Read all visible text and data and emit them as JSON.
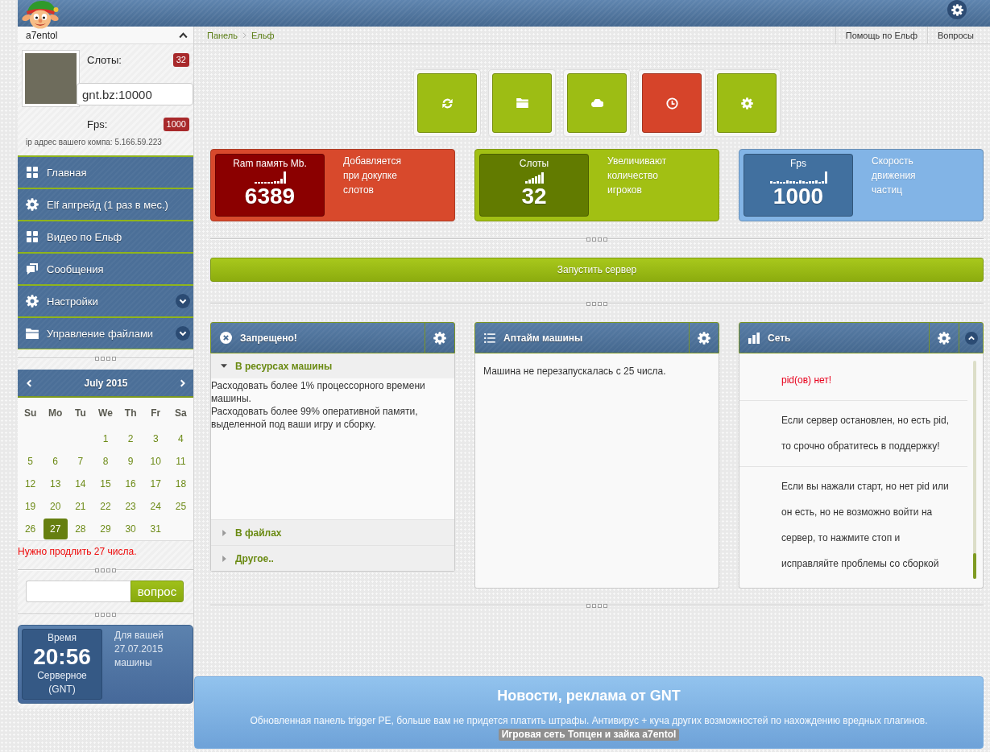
{
  "sidebar": {
    "user": {
      "name": "a7entol",
      "expanded": true
    },
    "profile": {
      "slots_label": "Слоты:",
      "slots_badge": "32",
      "server_field": {
        "value": "gnt.bz:10000"
      },
      "fps_label": "Fps:",
      "fps_badge": "1000",
      "ip_text": "ip адрес вашего компа: 5.166.59.223"
    },
    "menu": [
      {
        "label": "Главная",
        "has_submenu": false
      },
      {
        "label": "Elf апгрейд (1 раз в мес.)",
        "has_submenu": false
      },
      {
        "label": "Видео по Ельф",
        "has_submenu": false
      },
      {
        "label": "Сообщения",
        "has_submenu": false
      },
      {
        "label": "Настройки",
        "has_submenu": true
      },
      {
        "label": "Управление файлами",
        "has_submenu": true
      }
    ],
    "calendar": {
      "month": "July 2015",
      "weekdays": [
        "Su",
        "Mo",
        "Tu",
        "We",
        "Th",
        "Fr",
        "Sa"
      ],
      "weeks": [
        [
          {
            "day": "1",
            "selected": false
          },
          {
            "day": "2",
            "selected": false
          },
          {
            "day": "3",
            "selected": false
          },
          {
            "day": "4",
            "selected": false
          }
        ],
        [
          {
            "day": "5",
            "selected": false
          },
          {
            "day": "6",
            "selected": false
          },
          {
            "day": "7",
            "selected": false
          },
          {
            "day": "8",
            "selected": false
          },
          {
            "day": "9",
            "selected": false
          },
          {
            "day": "10",
            "selected": false
          },
          {
            "day": "11",
            "selected": false
          }
        ],
        [
          {
            "day": "12",
            "selected": false
          },
          {
            "day": "13",
            "selected": false
          },
          {
            "day": "14",
            "selected": false
          },
          {
            "day": "15",
            "selected": false
          },
          {
            "day": "16",
            "selected": false
          },
          {
            "day": "17",
            "selected": false
          },
          {
            "day": "18",
            "selected": false
          }
        ],
        [
          {
            "day": "19",
            "selected": false
          },
          {
            "day": "20",
            "selected": false
          },
          {
            "day": "21",
            "selected": false
          },
          {
            "day": "22",
            "selected": false
          },
          {
            "day": "23",
            "selected": false
          },
          {
            "day": "24",
            "selected": false
          },
          {
            "day": "25",
            "selected": false
          }
        ],
        [
          {
            "day": "26",
            "selected": false
          },
          {
            "day": "27",
            "selected": true
          },
          {
            "day": "28",
            "selected": false
          },
          {
            "day": "29",
            "selected": false
          },
          {
            "day": "30",
            "selected": false
          },
          {
            "day": "31",
            "selected": false
          }
        ]
      ]
    },
    "notice": "Нужно продлить 27 числа.",
    "question_form": {
      "button": "вопрос"
    },
    "clock": {
      "title": "Время",
      "time": "20:56",
      "zone": "Серверное (GNT)",
      "note": "Для вашей 27.07.2015 машины"
    }
  },
  "header": {
    "breadcrumb": [
      "Панель",
      "Ельф"
    ],
    "links": [
      "Помощь по Ельф",
      "Вопросы"
    ]
  },
  "quick_actions": [
    {
      "color": "#9dbd14"
    },
    {
      "color": "#9dbd14"
    },
    {
      "color": "#9dbd14"
    },
    {
      "color": "#d6442a"
    },
    {
      "color": "#9dbd14"
    }
  ],
  "stats": [
    {
      "label": "Ram память Mb.",
      "value": "6389",
      "description": "Добавляется при докупке слотов",
      "color": "#d8492c"
    },
    {
      "label": "Слоты",
      "value": "32",
      "description": "Увеличивают количество игроков",
      "color": "#a2c013"
    },
    {
      "label": "Fps",
      "value": "1000",
      "description": "Скорость движения частиц",
      "color": "#82b4e6"
    }
  ],
  "start_button": "Запустить сервер",
  "panels": [
    {
      "kind": "accordion",
      "title": "Запрещено!",
      "collapsible": false,
      "sections": [
        {
          "title": "В ресурсах машины",
          "expanded": true,
          "lines": [
            "Расходовать более 1% процессорного времени машины.",
            "Расходовать более 99% оперативной памяти, выделенной под ваши игру и сборку."
          ]
        },
        {
          "title": "В файлах",
          "expanded": false
        },
        {
          "title": "Другое..",
          "expanded": false
        }
      ]
    },
    {
      "kind": "text",
      "title": "Аптайм машины",
      "collapsible": false,
      "text": "Машина не перезапускалась с 25 числа."
    },
    {
      "kind": "feed",
      "title": "Сеть",
      "collapsible": true,
      "messages": [
        {
          "kind": "alert",
          "text": "pid(ов) нет!"
        },
        {
          "kind": "info",
          "text": "Если сервер остановлен, но есть pid, то срочно обратитесь в поддержку!"
        },
        {
          "kind": "info",
          "text": "Если вы нажали старт, но нет pid или он есть, но не возможно войти на сервер, то нажмите стоп и исправляйте проблемы со сборкой"
        }
      ]
    }
  ],
  "news": {
    "title": "Новости, реклама от GNT",
    "text": "Обновленная панель trigger PE, больше вам не придется платить штрафы. Антивирус + куча других возможностей по нахождению вредных плагинов.",
    "tag": "Игровая сеть Топцен и зайка a7entol"
  }
}
